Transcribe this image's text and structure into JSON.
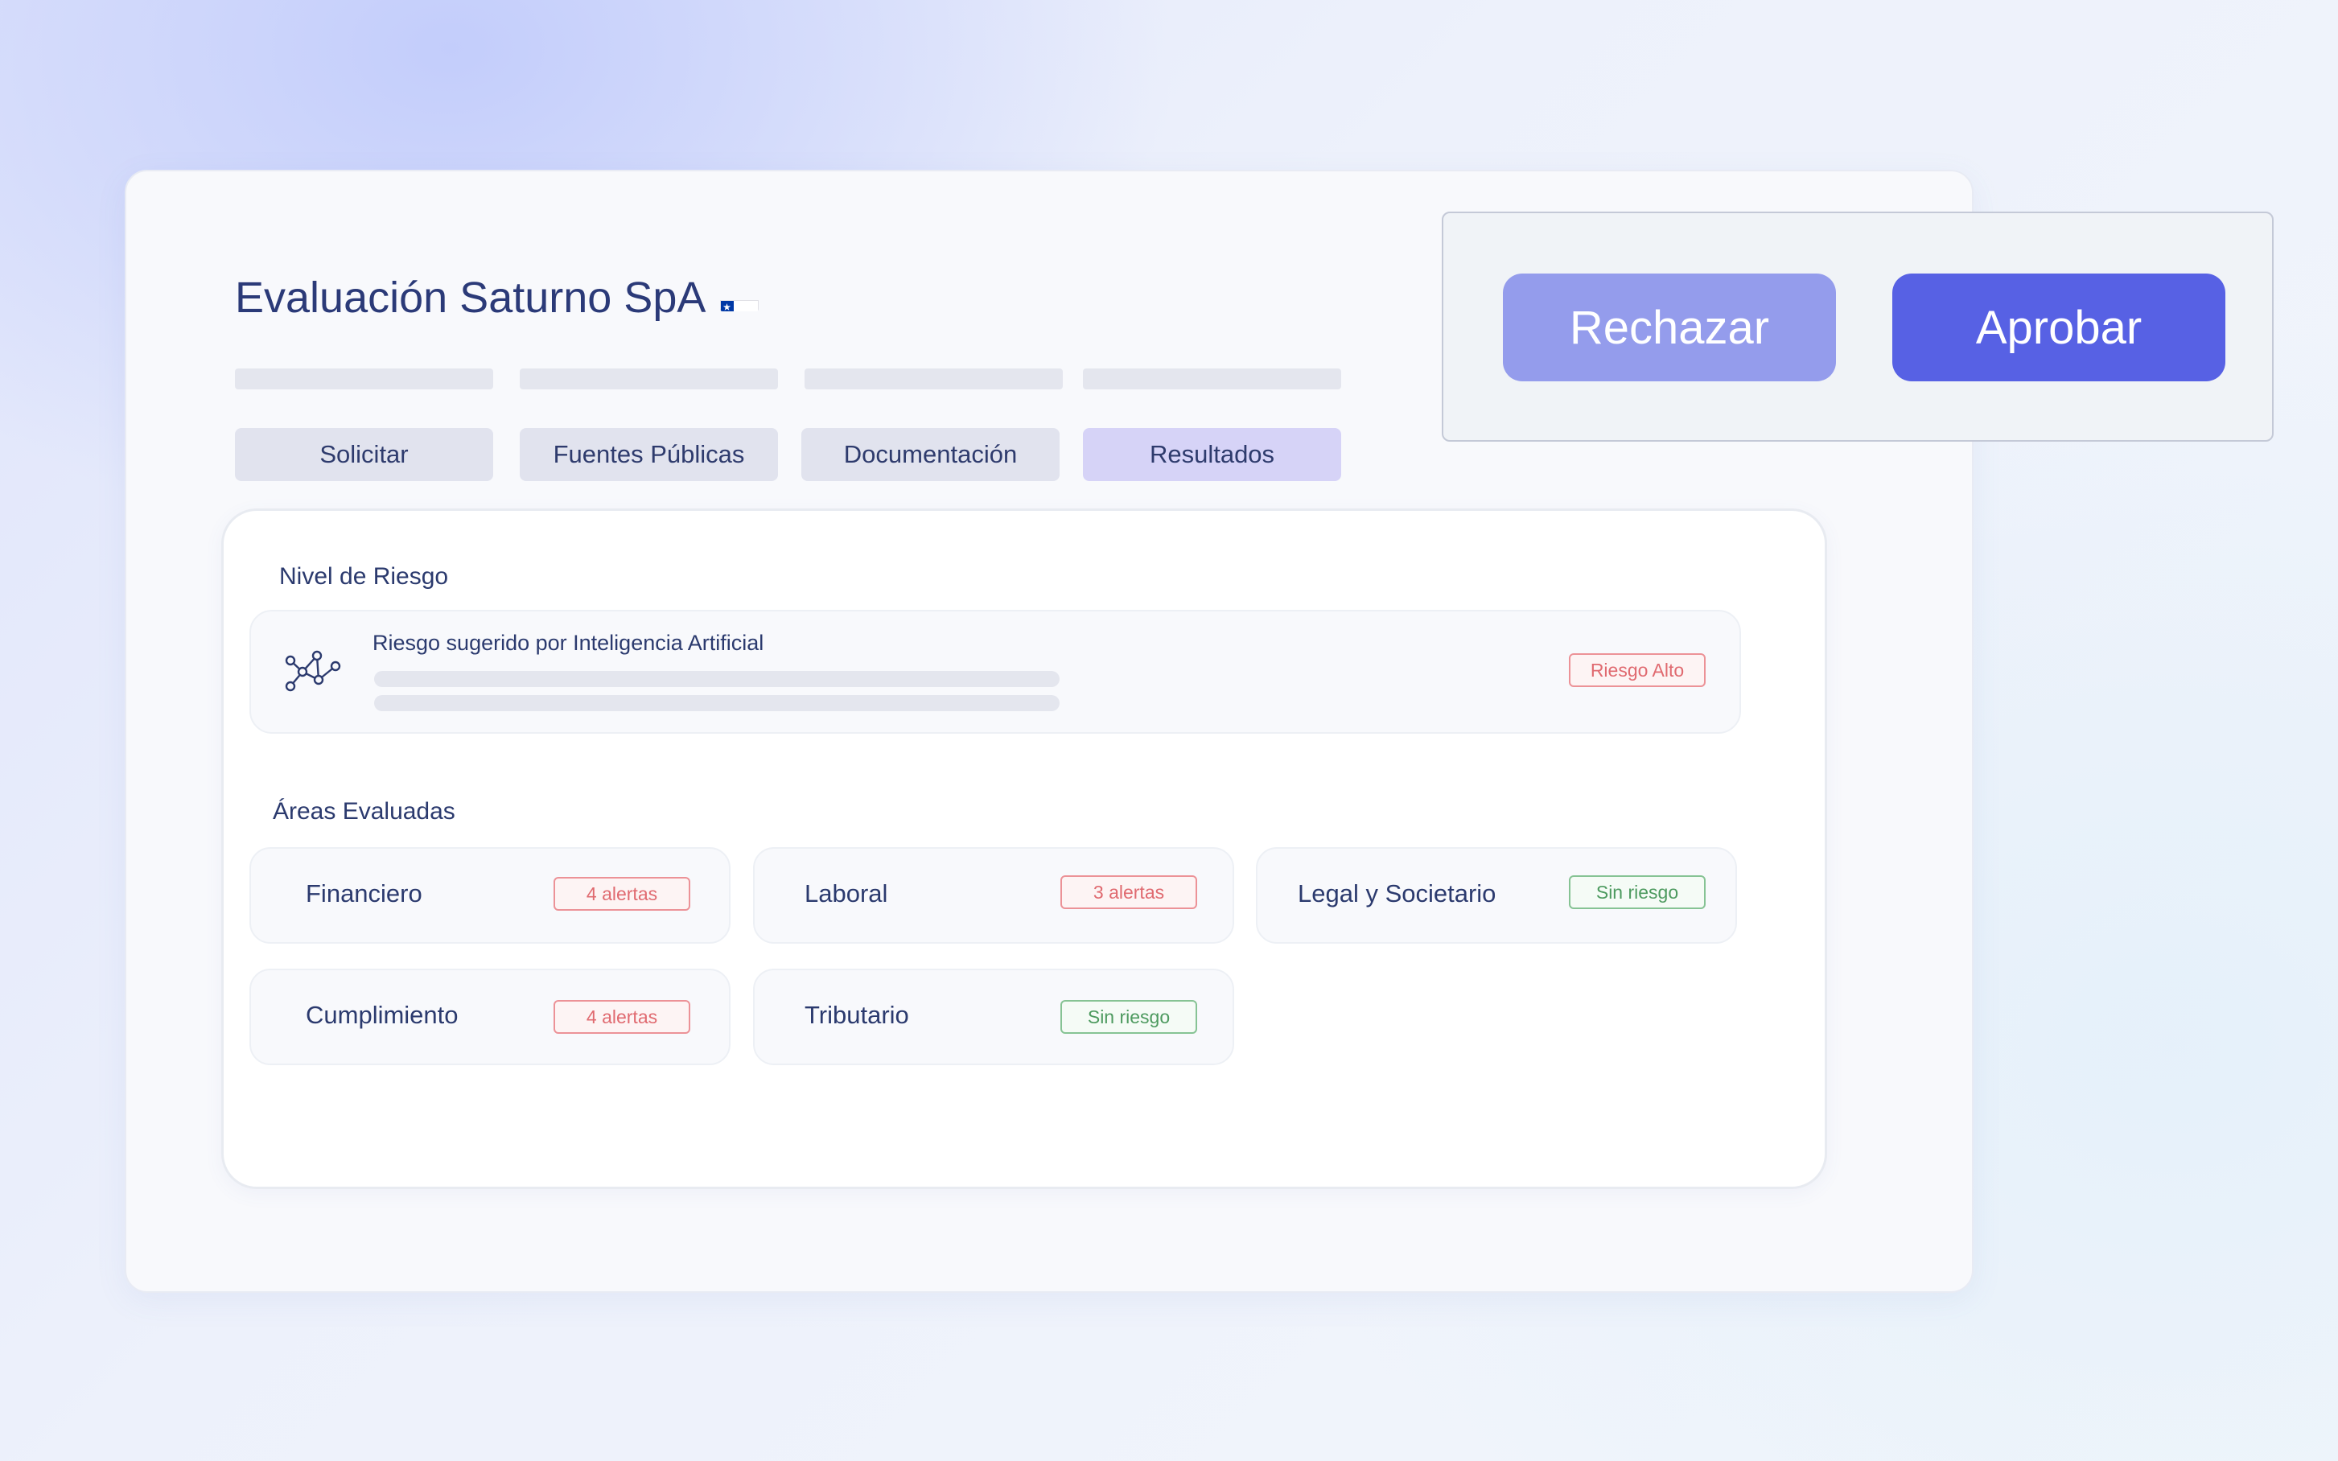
{
  "page": {
    "title": "Evaluación Saturno SpA",
    "flag": "chile-flag-icon"
  },
  "tabs": [
    {
      "label": "Solicitar",
      "active": false
    },
    {
      "label": "Fuentes Públicas",
      "active": false
    },
    {
      "label": "Documentación",
      "active": false
    },
    {
      "label": "Resultados",
      "active": true
    }
  ],
  "risk": {
    "section_title": "Nivel de Riesgo",
    "icon": "ai-network-icon",
    "label": "Riesgo sugerido por Inteligencia Artificial",
    "badge": "Riesgo Alto"
  },
  "areas": {
    "section_title": "Áreas Evaluadas",
    "items": [
      {
        "name": "Financiero",
        "status": "4 alertas",
        "level": "alert"
      },
      {
        "name": "Laboral",
        "status": "3 alertas",
        "level": "alert"
      },
      {
        "name": "Legal y Societario",
        "status": "Sin riesgo",
        "level": "ok"
      },
      {
        "name": "Cumplimiento",
        "status": "4 alertas",
        "level": "alert"
      },
      {
        "name": "Tributario",
        "status": "Sin riesgo",
        "level": "ok"
      }
    ]
  },
  "actions": {
    "reject_label": "Rechazar",
    "approve_label": "Aprobar"
  },
  "colors": {
    "primary": "#5761e4",
    "primary_light": "#949cec",
    "alert": "#e06a70",
    "ok": "#4d9a5f",
    "tab_active": "#d6d3f7"
  }
}
